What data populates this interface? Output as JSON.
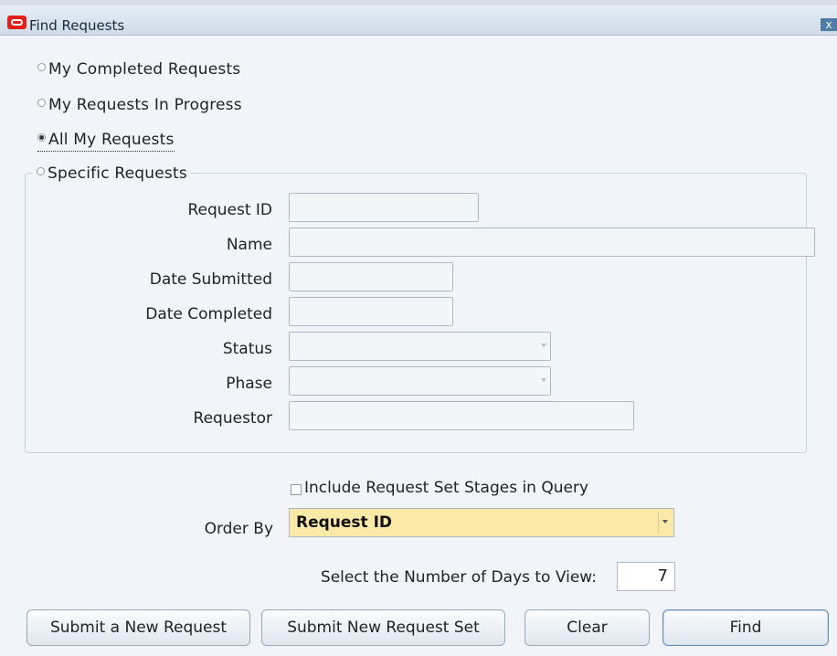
{
  "window": {
    "title": "Find Requests",
    "close_glyph": "x"
  },
  "scope_options": [
    {
      "label": "My Completed Requests",
      "checked": false
    },
    {
      "label": "My Requests In Progress",
      "checked": false
    },
    {
      "label": "All My Requests",
      "checked": true
    },
    {
      "label": "Specific Requests",
      "checked": false
    }
  ],
  "specific": {
    "request_id_label": "Request ID",
    "name_label": "Name",
    "date_submitted_label": "Date Submitted",
    "date_completed_label": "Date Completed",
    "status_label": "Status",
    "phase_label": "Phase",
    "requestor_label": "Requestor"
  },
  "include_stages_label": "Include Request Set Stages in Query",
  "include_stages_checked": false,
  "order_by": {
    "label": "Order By",
    "value": "Request ID"
  },
  "days": {
    "label": "Select the Number of Days to View:",
    "value": "7"
  },
  "buttons": {
    "submit_new_request": "Submit a New Request",
    "submit_new_request_set": "Submit New Request Set",
    "clear": "Clear",
    "find": "Find"
  },
  "colors": {
    "accent": "#fbe9a7",
    "panel": "#f1f5f9",
    "logo": "#e0201b"
  },
  "icons": [
    "oracle-logo-icon",
    "close-icon",
    "dropdown-arrow-icon"
  ]
}
